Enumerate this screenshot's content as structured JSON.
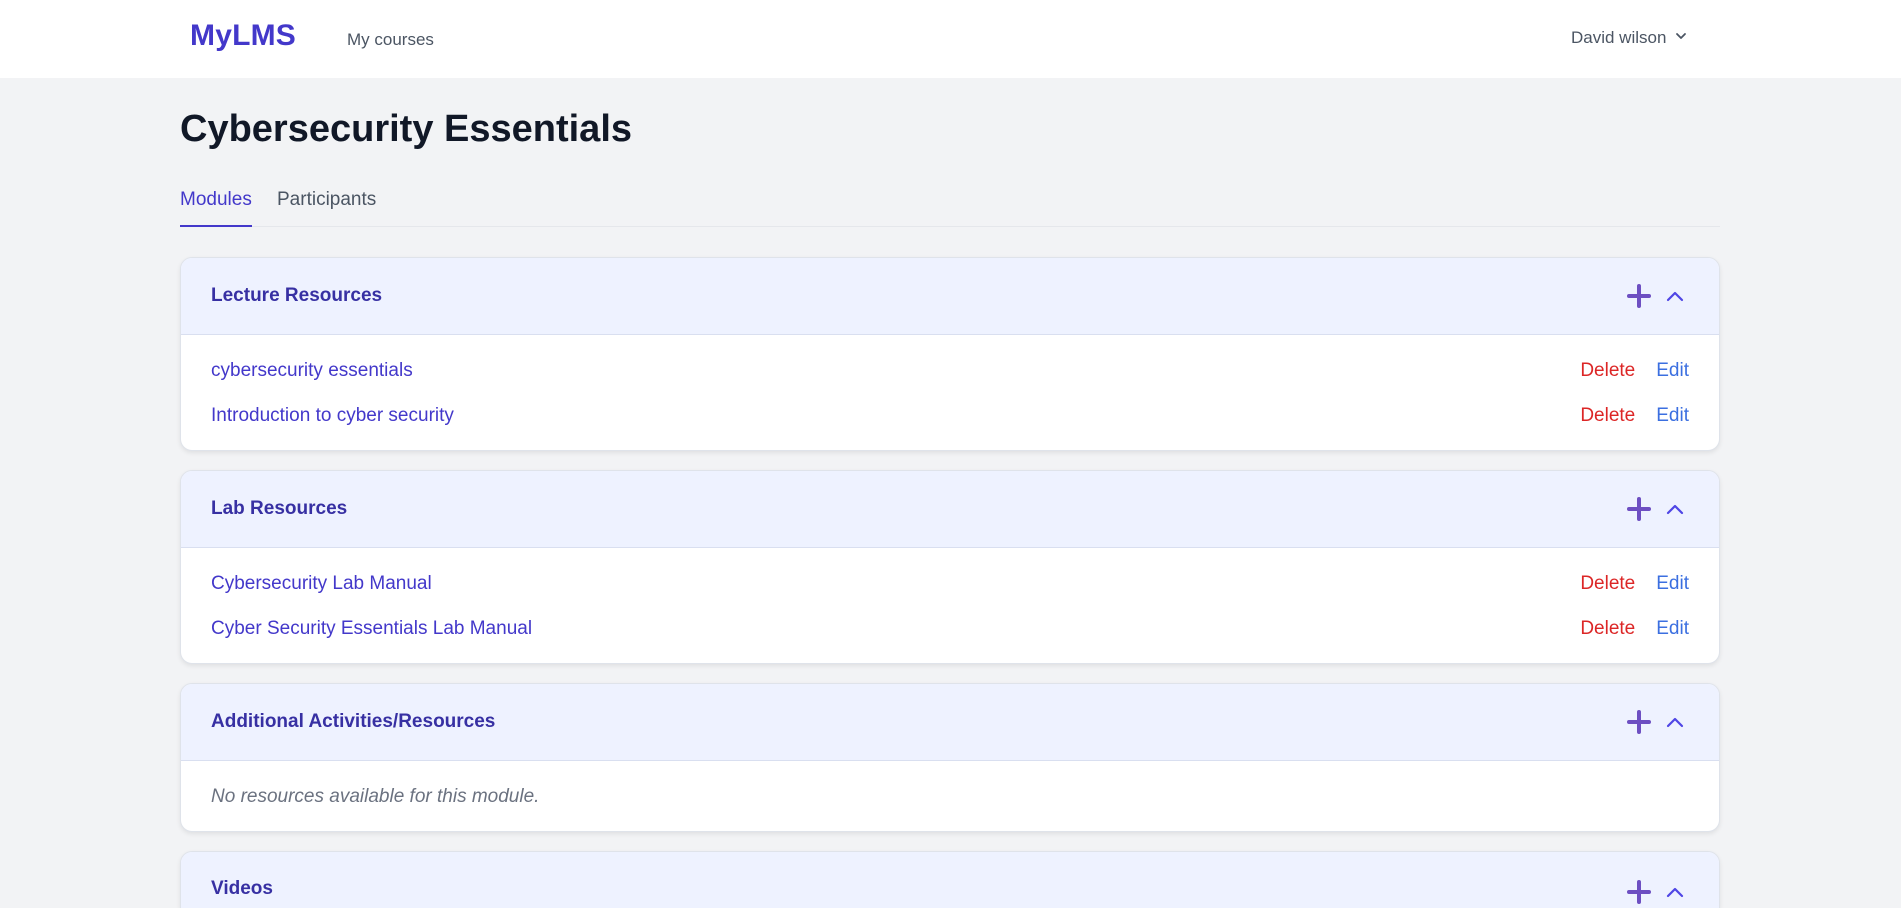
{
  "app": {
    "logo": "MyLMS"
  },
  "nav": {
    "my_courses": "My courses"
  },
  "user": {
    "name": "David wilson"
  },
  "course": {
    "title": "Cybersecurity Essentials"
  },
  "tabs": [
    {
      "label": "Modules"
    },
    {
      "label": "Participants"
    }
  ],
  "actions": {
    "delete": "Delete",
    "edit": "Edit"
  },
  "modules": [
    {
      "title": "Lecture Resources",
      "resources": [
        {
          "name": "cybersecurity essentials"
        },
        {
          "name": "Introduction to cyber security"
        }
      ]
    },
    {
      "title": "Lab Resources",
      "resources": [
        {
          "name": "Cybersecurity Lab Manual"
        },
        {
          "name": "Cyber Security Essentials Lab Manual"
        }
      ]
    },
    {
      "title": "Additional Activities/Resources",
      "empty_text": "No resources available for this module."
    },
    {
      "title": "Videos"
    }
  ],
  "icons": {
    "add": "plus-icon",
    "collapse": "chevron-up-icon",
    "user_menu": "chevron-down-icon"
  },
  "colors": {
    "brand": "#4338ca",
    "plus_icon": "#6d4fc2",
    "delete": "#dc2626",
    "edit": "#3b6fe0",
    "module_header_bg": "#eef2ff",
    "page_bg": "#f2f3f5"
  }
}
